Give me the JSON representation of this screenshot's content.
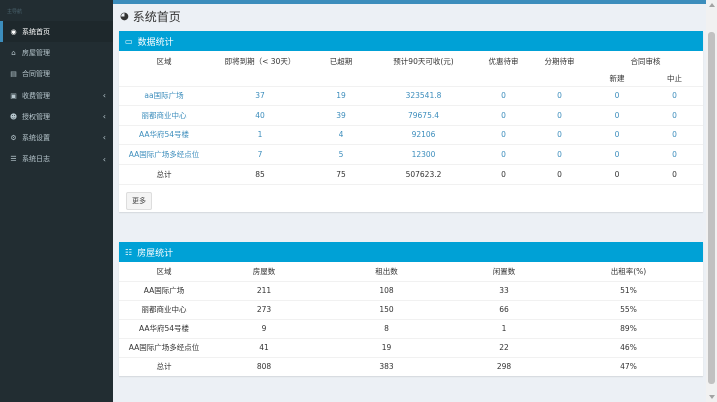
{
  "sidebar": {
    "header": "主导航",
    "items": [
      {
        "label": "系统首页",
        "icon": "dashboard-icon",
        "active": true,
        "chevron": false
      },
      {
        "label": "房屋管理",
        "icon": "home-icon",
        "active": false,
        "chevron": false
      },
      {
        "label": "合同管理",
        "icon": "file-icon",
        "active": false,
        "chevron": false
      },
      {
        "label": "收费管理",
        "icon": "money-icon",
        "active": false,
        "chevron": true
      },
      {
        "label": "授权管理",
        "icon": "users-icon",
        "active": false,
        "chevron": true
      },
      {
        "label": "系统设置",
        "icon": "gears-icon",
        "active": false,
        "chevron": true
      },
      {
        "label": "系统日志",
        "icon": "log-icon",
        "active": false,
        "chevron": true
      }
    ]
  },
  "page": {
    "title": "系统首页"
  },
  "stats": {
    "title": "数据统计",
    "headers": {
      "area": "区域",
      "expiring": "即将到期（< 30天）",
      "expired": "已超期",
      "expected": "预计90天可收(元)",
      "discount": "优惠待审",
      "installment": "分期待审",
      "contract": "合同审核",
      "new": "新建",
      "stop": "中止"
    },
    "rows": [
      {
        "area": "aa国际广场",
        "expiring": "37",
        "expired": "19",
        "expected": "323541.8",
        "discount": "0",
        "installment": "0",
        "new": "0",
        "stop": "0"
      },
      {
        "area": "丽都商业中心",
        "expiring": "40",
        "expired": "39",
        "expected": "79675.4",
        "discount": "0",
        "installment": "0",
        "new": "0",
        "stop": "0"
      },
      {
        "area": "AA华府54号楼",
        "expiring": "1",
        "expired": "4",
        "expected": "92106",
        "discount": "0",
        "installment": "0",
        "new": "0",
        "stop": "0"
      },
      {
        "area": "AA国际广场多经点位",
        "expiring": "7",
        "expired": "5",
        "expected": "12300",
        "discount": "0",
        "installment": "0",
        "new": "0",
        "stop": "0"
      }
    ],
    "total": {
      "area": "总计",
      "expiring": "85",
      "expired": "75",
      "expected": "507623.2",
      "discount": "0",
      "installment": "0",
      "new": "0",
      "stop": "0"
    },
    "more_label": "更多"
  },
  "housing": {
    "title": "房屋统计",
    "headers": {
      "area": "区域",
      "count": "房屋数",
      "rented": "租出数",
      "idle": "闲置数",
      "rate": "出租率(%)"
    },
    "rows": [
      {
        "area": "AA国际广场",
        "count": "211",
        "rented": "108",
        "idle": "33",
        "rate": "51%"
      },
      {
        "area": "丽都商业中心",
        "count": "273",
        "rented": "150",
        "idle": "66",
        "rate": "55%"
      },
      {
        "area": "AA华府54号楼",
        "count": "9",
        "rented": "8",
        "idle": "1",
        "rate": "89%"
      },
      {
        "area": "AA国际广场多经点位",
        "count": "41",
        "rented": "19",
        "idle": "22",
        "rate": "46%"
      }
    ],
    "total": {
      "area": "总计",
      "count": "808",
      "rented": "383",
      "idle": "298",
      "rate": "47%"
    }
  },
  "colors": {
    "accent": "#00a1d6",
    "sidebar": "#222d32",
    "link": "#3c8dbc"
  }
}
